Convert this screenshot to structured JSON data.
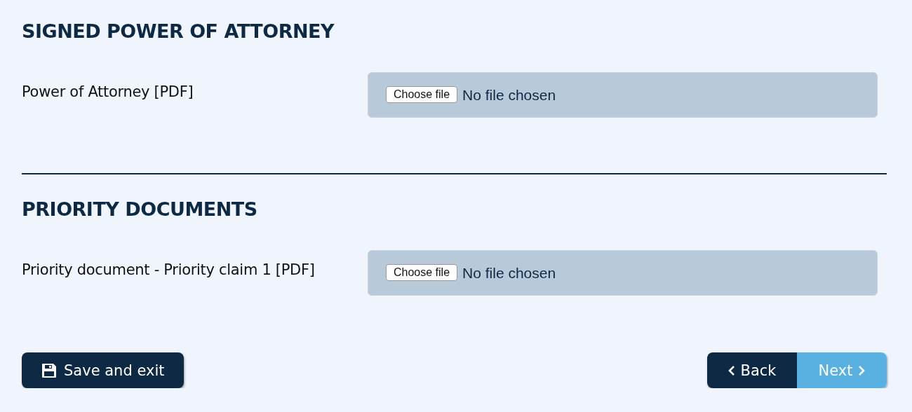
{
  "sections": [
    {
      "title": "SIGNED POWER OF ATTORNEY",
      "fields": [
        {
          "label": "Power of Attorney [PDF]",
          "button": "Choose file",
          "status": "No file chosen"
        }
      ]
    },
    {
      "title": "PRIORITY DOCUMENTS",
      "fields": [
        {
          "label": "Priority document - Priority claim 1 [PDF]",
          "button": "Choose file",
          "status": "No file chosen"
        }
      ]
    }
  ],
  "actions": {
    "save": "Save and exit",
    "nav": [
      {
        "kind": "back",
        "label": "Back"
      },
      {
        "kind": "next",
        "label": "Next"
      }
    ]
  }
}
